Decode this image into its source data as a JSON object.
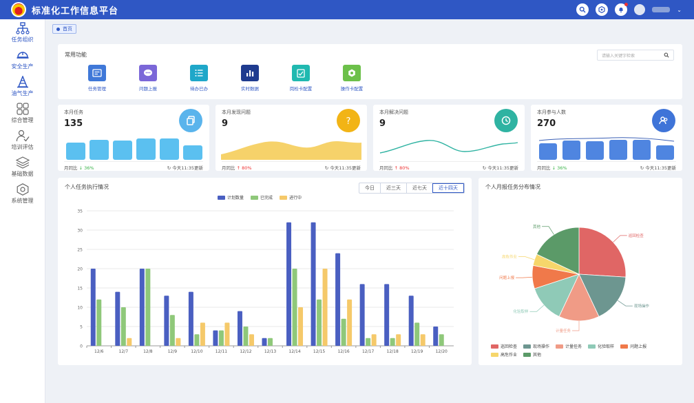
{
  "app": {
    "title": "标准化工作信息平台"
  },
  "colors": {
    "primary": "#2f57c4",
    "plan": "#4a5fc1",
    "done": "#8fc87a",
    "progress": "#f5c96a"
  },
  "sidebar": {
    "items": [
      {
        "label": "任务组织",
        "icon": "org-icon"
      },
      {
        "label": "安全生产",
        "icon": "helmet-icon"
      },
      {
        "label": "油气生产",
        "icon": "oil-rig-icon"
      },
      {
        "label": "综合管理",
        "icon": "grid-icon"
      },
      {
        "label": "培训评估",
        "icon": "training-icon"
      },
      {
        "label": "基础数据",
        "icon": "layers-icon"
      },
      {
        "label": "系统管理",
        "icon": "gear-icon"
      }
    ]
  },
  "tabs": {
    "home": "首页"
  },
  "quick": {
    "title": "常用功能",
    "search_placeholder": "请输入关键字检索",
    "items": [
      {
        "label": "任务管理",
        "icon": "task-icon",
        "color": "#3f78d8"
      },
      {
        "label": "问题上报",
        "icon": "chat-icon",
        "color": "#7b67d8"
      },
      {
        "label": "待办已办",
        "icon": "list-icon",
        "color": "#1fa7c9"
      },
      {
        "label": "实时数据",
        "icon": "bar-chart-icon",
        "color": "#1f3b8f"
      },
      {
        "label": "岗检卡配置",
        "icon": "check-card-icon",
        "color": "#20b9b0"
      },
      {
        "label": "操作卡配置",
        "icon": "gear-card-icon",
        "color": "#6cc04a"
      }
    ]
  },
  "stats": [
    {
      "title": "本月任务",
      "value": "135",
      "compare_label": "月同比",
      "arrow": "↓",
      "pct": "36%",
      "dir": "down",
      "update": "今天11:35更新",
      "icon": "copy-icon",
      "icon_color": "#5ab4ec"
    },
    {
      "title": "本月发现问题",
      "value": "9",
      "compare_label": "月同比",
      "arrow": "↑",
      "pct": "80%",
      "dir": "up",
      "update": "今天11:35更新",
      "icon": "question-icon",
      "icon_color": "#f2b416"
    },
    {
      "title": "本月解决问题",
      "value": "9",
      "compare_label": "月同比",
      "arrow": "↑",
      "pct": "80%",
      "dir": "up",
      "update": "今天11:35更新",
      "icon": "clock-check-icon",
      "icon_color": "#2fb3a2"
    },
    {
      "title": "本月参与人数",
      "value": "270",
      "compare_label": "月同比",
      "arrow": "↓",
      "pct": "36%",
      "dir": "down",
      "update": "今天11:35更新",
      "icon": "users-icon",
      "icon_color": "#3f74d8"
    }
  ],
  "bar_section": {
    "title": "个人任务执行情况",
    "ranges": [
      "今日",
      "近三天",
      "近七天",
      "近十四天"
    ],
    "active_range": 3
  },
  "pie_section": {
    "title": "个人月报任务分布情况"
  },
  "chart_data": [
    {
      "type": "bar",
      "categories": [
        "12/6",
        "12/7",
        "12/8",
        "12/9",
        "12/10",
        "12/11",
        "12/12",
        "12/13",
        "12/14",
        "12/15",
        "12/16",
        "12/17",
        "12/18",
        "12/19",
        "12/20"
      ],
      "series": [
        {
          "name": "计划数量",
          "color": "#4a5fc1",
          "values": [
            20,
            14,
            20,
            13,
            14,
            4,
            9,
            2,
            32,
            32,
            24,
            16,
            16,
            13,
            5
          ]
        },
        {
          "name": "已完成",
          "color": "#8fc87a",
          "values": [
            12,
            10,
            20,
            8,
            3,
            4,
            5,
            2,
            20,
            12,
            7,
            2,
            2,
            6,
            3
          ]
        },
        {
          "name": "进行中",
          "color": "#f5c96a",
          "values": [
            0,
            2,
            0,
            2,
            6,
            6,
            3,
            0,
            10,
            20,
            12,
            3,
            3,
            3,
            0
          ]
        }
      ],
      "ylim": [
        0,
        35
      ],
      "yticks": [
        "0",
        "5",
        "10",
        "15",
        "20",
        "25",
        "30",
        "35"
      ],
      "grid": true
    },
    {
      "type": "pie",
      "slices": [
        {
          "label": "巡回检查",
          "value": 26,
          "color": "#e06665"
        },
        {
          "label": "现场操作",
          "value": 17,
          "color": "#6d9690"
        },
        {
          "label": "计量任务",
          "value": 14,
          "color": "#f09b86"
        },
        {
          "label": "化验取样",
          "value": 13,
          "color": "#8fcab7"
        },
        {
          "label": "问题上报",
          "value": 8,
          "color": "#f0794a"
        },
        {
          "label": "高危作业",
          "value": 4,
          "color": "#f6d66b"
        },
        {
          "label": "其他",
          "value": 18,
          "color": "#5b9a68"
        }
      ],
      "legend": "bottom"
    }
  ]
}
